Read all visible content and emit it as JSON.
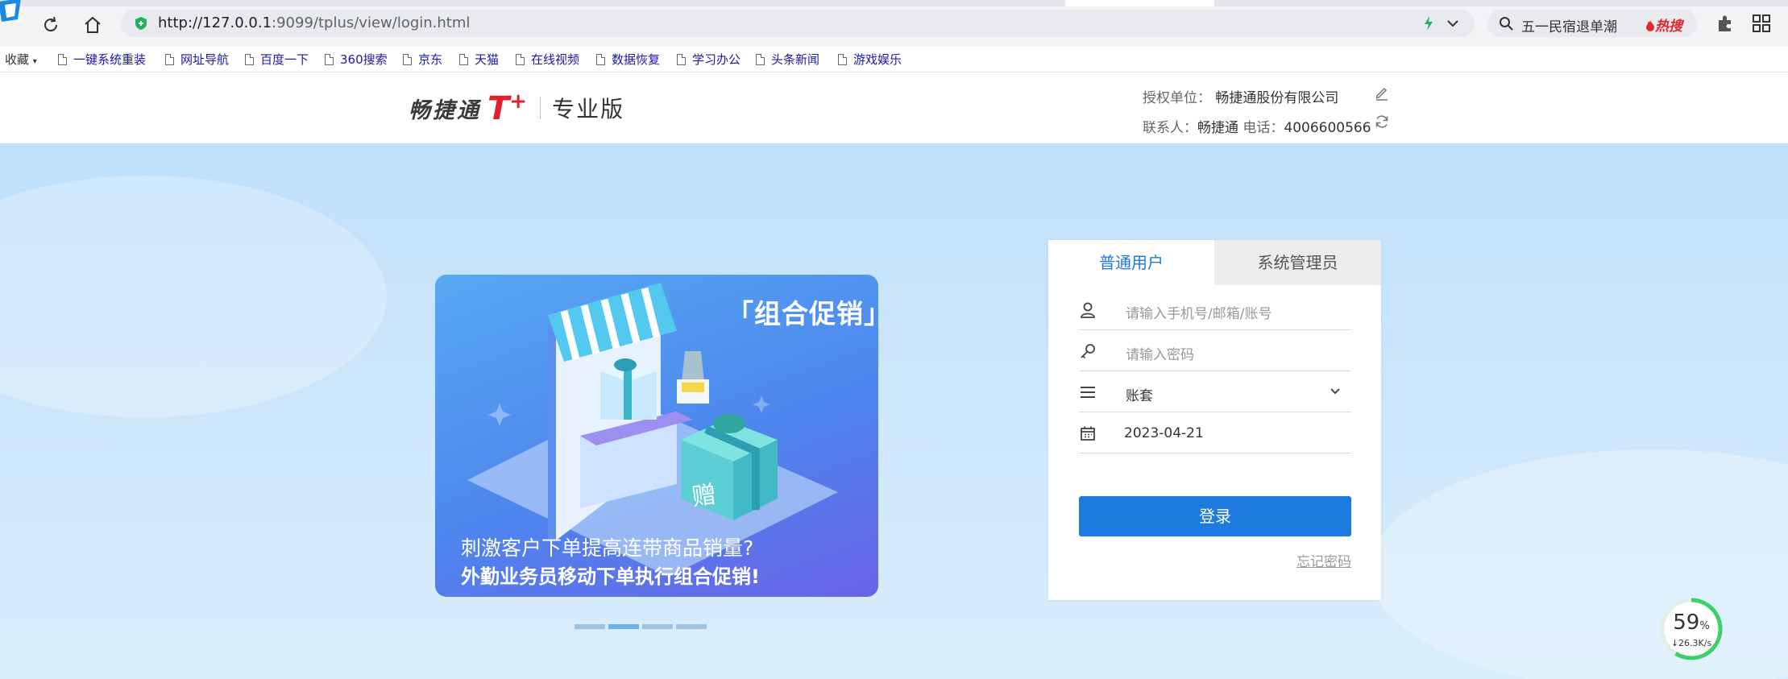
{
  "browser": {
    "url_host": "http://127.0.0.1",
    "url_rest": ":9099/tplus/view/login.html",
    "search_text": "五一民宿退单潮",
    "search_hot_label": "热搜"
  },
  "bookmarks": {
    "favorites_label": "收藏",
    "items": [
      "一键系统重装",
      "网址导航",
      "百度一下",
      "360搜索",
      "京东",
      "天猫",
      "在线视频",
      "数据恢复",
      "学习办公",
      "头条新闻",
      "游戏娱乐"
    ]
  },
  "header": {
    "brand": "畅捷通",
    "product": "T",
    "product_plus": "+",
    "edition": "专业版",
    "org_label": "授权单位：",
    "org_value": "畅捷通股份有限公司",
    "contact_label": "联系人：",
    "contact_value": "畅捷通",
    "phone_label": "电话：",
    "phone_value": "4006600566"
  },
  "banner": {
    "title": "「组合促销」",
    "gift_char": "赠",
    "line1": "刺激客户下单提高连带商品销量?",
    "line2": "外勤业务员移动下单执行组合促销!",
    "active_slide": 2,
    "slide_count": 4
  },
  "login": {
    "tab_user": "普通用户",
    "tab_admin": "系统管理员",
    "username_placeholder": "请输入手机号/邮箱/账号",
    "password_placeholder": "请输入密码",
    "account_set": "账套",
    "date": "2023-04-21",
    "submit": "登录",
    "forgot": "忘记密码"
  },
  "network": {
    "percent": "59",
    "percent_unit": "%",
    "speed": "↓26.3K/s",
    "usage_fraction": 0.59
  },
  "colors": {
    "primary": "#1f7ae0",
    "brand_red": "#e0202a",
    "page_bg": "#c8e4fa"
  }
}
